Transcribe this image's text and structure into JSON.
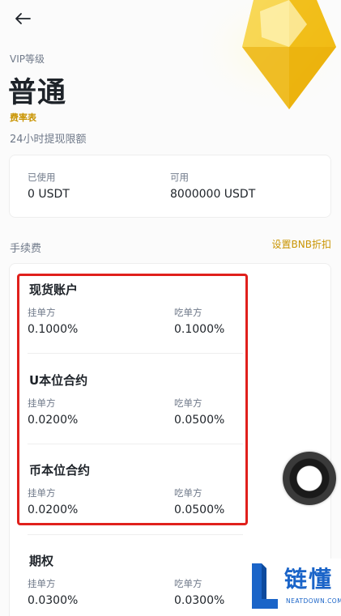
{
  "header": {
    "back_icon": "arrow-left-icon"
  },
  "vip": {
    "label": "VIP等级",
    "level": "普通",
    "fee_table_link": "费率表"
  },
  "limit": {
    "title": "24小时提现限额",
    "used_label": "已使用",
    "used_value": "0 USDT",
    "available_label": "可用",
    "available_value": "8000000 USDT"
  },
  "fees": {
    "title": "手续费",
    "bnb_link": "设置BNB折扣",
    "sections": [
      {
        "name": "现货账户",
        "maker_label": "挂单方",
        "maker_value": "0.1000%",
        "taker_label": "吃单方",
        "taker_value": "0.1000%"
      },
      {
        "name": "U本位合约",
        "maker_label": "挂单方",
        "maker_value": "0.0200%",
        "taker_label": "吃单方",
        "taker_value": "0.0500%"
      },
      {
        "name": "币本位合约",
        "maker_label": "挂单方",
        "maker_value": "0.0200%",
        "taker_label": "吃单方",
        "taker_value": "0.0500%"
      },
      {
        "name": "期权",
        "maker_label": "挂单方",
        "maker_value": "0.0300%",
        "taker_label": "吃单方",
        "taker_value": "0.0300%"
      }
    ]
  },
  "watermark": {
    "text": "链懂",
    "sub": "NEATDOWN.COM"
  },
  "colors": {
    "accent": "#c99400",
    "highlight": "#e0201c",
    "gem": "#f5c518",
    "watermark": "#1a64c8"
  }
}
